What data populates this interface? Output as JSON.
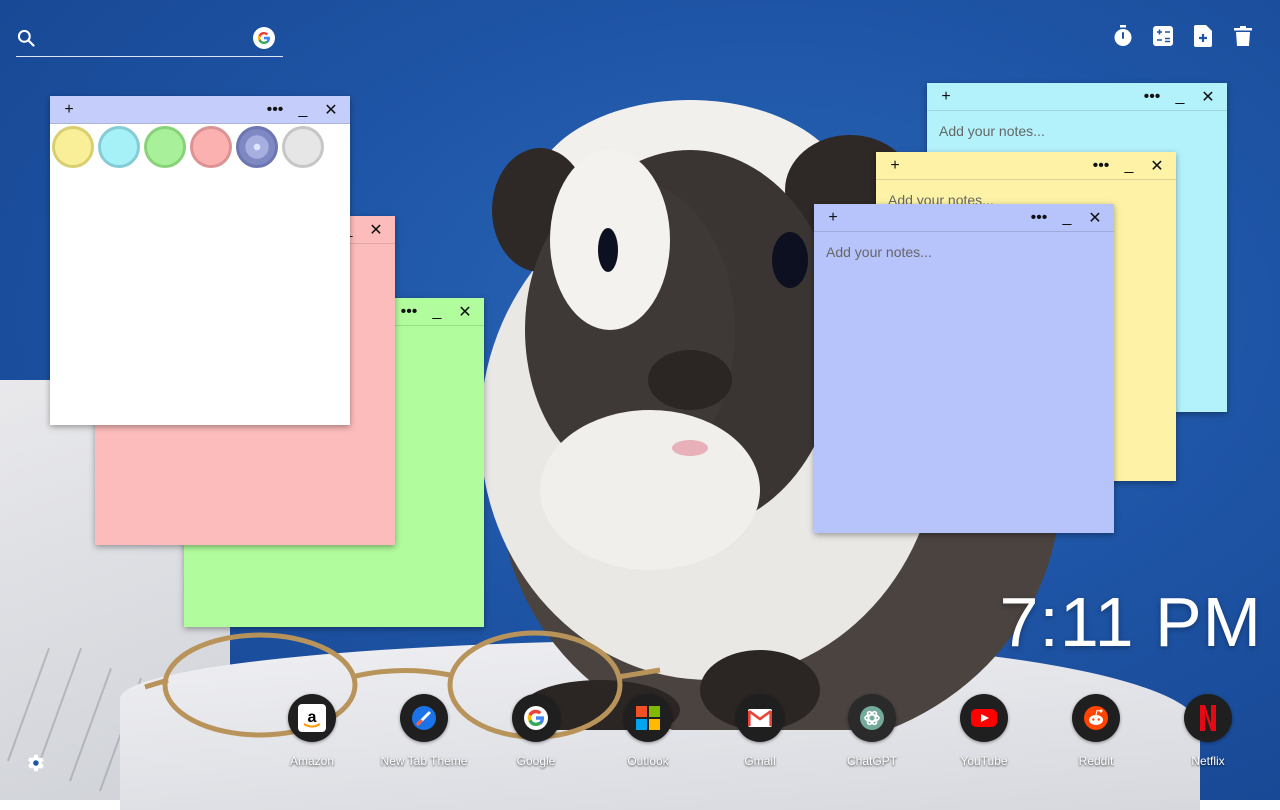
{
  "search": {
    "placeholder": ""
  },
  "toolbar": {
    "icons": [
      "timer-icon",
      "calculator-icon",
      "new-note-icon",
      "trash-icon"
    ]
  },
  "notes": {
    "white": {
      "add": "+",
      "more": "•••",
      "min": "_",
      "close": "✕",
      "colors": [
        "#f9ef98",
        "#a6f0f8",
        "#a8f19a",
        "#fcb1b1",
        "#8d96c8",
        "#e6e6e6"
      ]
    },
    "pink": {
      "min": "_",
      "close": "✕",
      "placeholder": ""
    },
    "green": {
      "more": "•••",
      "min": "_",
      "close": "✕",
      "placeholder": ""
    },
    "cyan": {
      "add": "+",
      "more": "•••",
      "min": "_",
      "close": "✕",
      "placeholder": "Add your notes..."
    },
    "yellow": {
      "add": "+",
      "more": "•••",
      "min": "_",
      "close": "✕",
      "placeholder": "Add your notes..."
    },
    "blue": {
      "add": "+",
      "more": "•••",
      "min": "_",
      "close": "✕",
      "placeholder": "Add your notes..."
    }
  },
  "clock": {
    "time": "7:11 PM"
  },
  "shortcuts": [
    {
      "label": "Amazon"
    },
    {
      "label": "New Tab Theme"
    },
    {
      "label": "Google"
    },
    {
      "label": "Outlook"
    },
    {
      "label": "Gmail"
    },
    {
      "label": "ChatGPT"
    },
    {
      "label": "YouTube"
    },
    {
      "label": "Reddit"
    },
    {
      "label": "Netflix"
    }
  ],
  "colors": {
    "note_white": "#ffffff",
    "note_pink": "#fdbcbc",
    "note_green": "#b1fc9c",
    "note_cyan": "#b4f2fb",
    "note_yellow": "#fdf2a5",
    "note_blue": "#b7c3fb",
    "note_head_white": "#c5cdfb"
  }
}
